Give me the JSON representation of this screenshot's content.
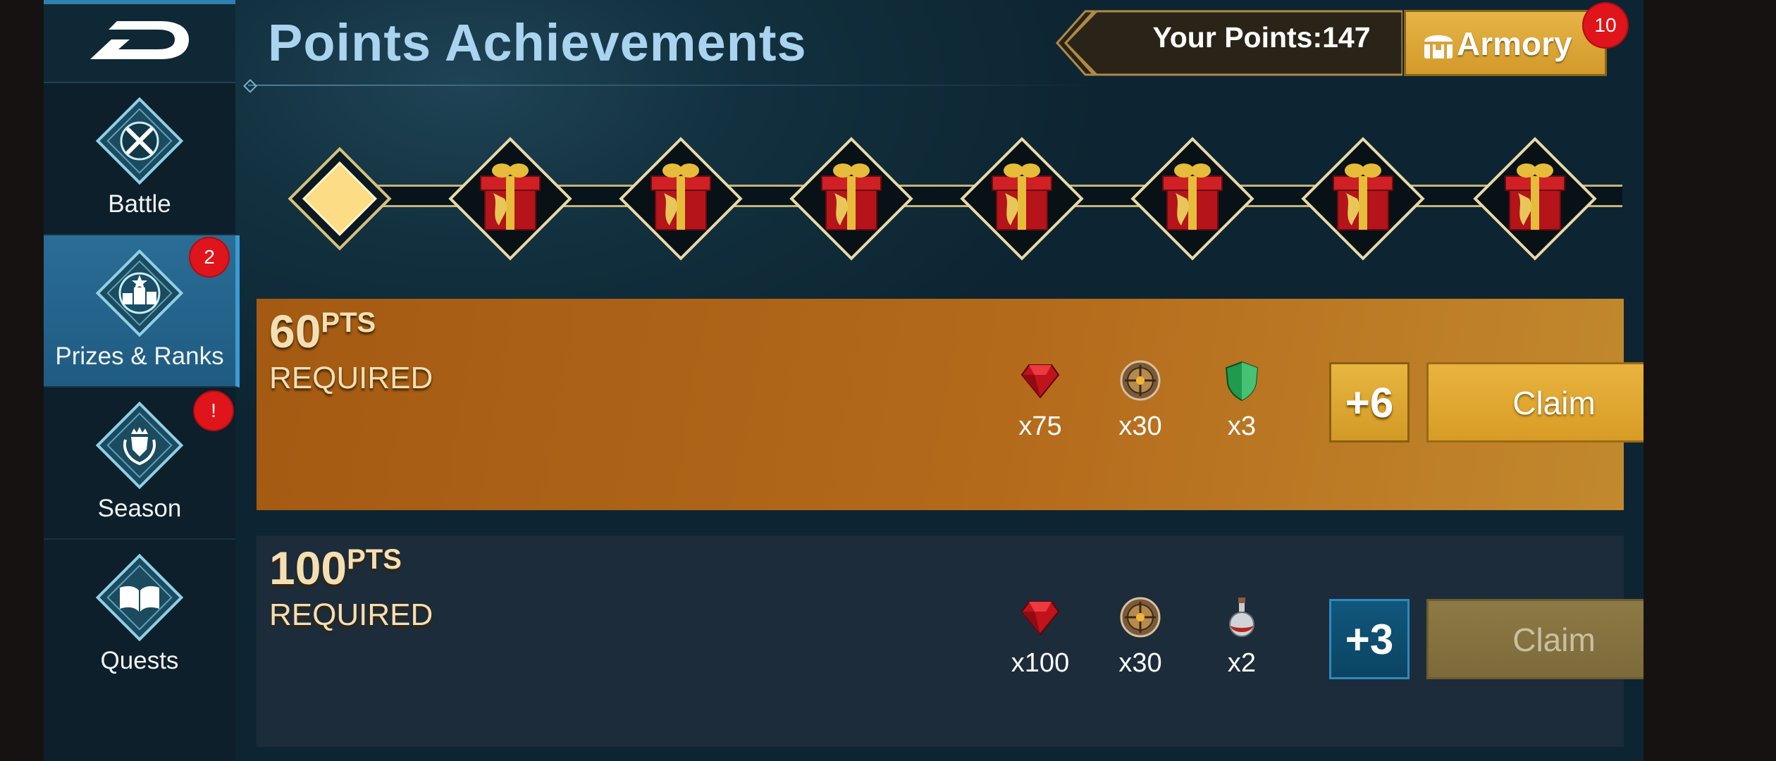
{
  "header": {
    "title": "Points Achievements",
    "points_text": "Your Points:147",
    "armory_label": "Armory",
    "armory_badge": "10"
  },
  "sidebar": {
    "items": [
      {
        "label": "Battle",
        "badge": ""
      },
      {
        "label": "Prizes & Ranks",
        "badge": "2"
      },
      {
        "label": "Season",
        "badge": "!"
      },
      {
        "label": "Quests",
        "badge": ""
      }
    ]
  },
  "track": {
    "nodes": [
      "claimed-marker",
      "gift",
      "gift",
      "gift",
      "gift",
      "gift",
      "gift",
      "gift"
    ]
  },
  "rewards": [
    {
      "points": "60",
      "unit": "PTS",
      "required": "REQUIRED",
      "items": [
        {
          "icon": "ruby-gem-icon",
          "qty": "x75"
        },
        {
          "icon": "emblem-coin-icon",
          "qty": "x30"
        },
        {
          "icon": "green-shield-icon",
          "qty": "x3"
        }
      ],
      "bonus": "+6",
      "claim": "Claim",
      "claimable": true
    },
    {
      "points": "100",
      "unit": "PTS",
      "required": "REQUIRED",
      "items": [
        {
          "icon": "ruby-gem-icon",
          "qty": "x100"
        },
        {
          "icon": "emblem-coin-icon",
          "qty": "x30"
        },
        {
          "icon": "potion-bottle-icon",
          "qty": "x2"
        }
      ],
      "bonus": "+3",
      "claim": "Claim",
      "claimable": false
    }
  ],
  "colors": {
    "accent_gold": "#d9a12c",
    "title_blue": "#a9d3ef",
    "badge_red": "#e0141b"
  }
}
